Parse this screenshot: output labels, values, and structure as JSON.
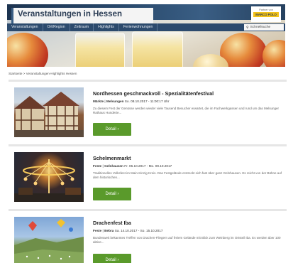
{
  "header": {
    "title": "Veranstaltungen in Hessen",
    "partner_small": "Partner von",
    "partner_brand": "MARCO POLO"
  },
  "nav": {
    "items": [
      "Veranstaltungen",
      "Ort/Region",
      "Zeitraum",
      "Highlights",
      "Ferienwohnungen"
    ],
    "search_label": "Schnellsuche",
    "search_icon": "search-icon"
  },
  "breadcrumb": "Startseite > Veranstaltungen-Highlights Hessen",
  "events": [
    {
      "title": "Nordhessen geschmackvoll - Spezialitätenfestival",
      "category": "Märkte",
      "location": "Melsungen",
      "date": "So. 08.10.2017 - 11:00:17 Uhr",
      "description": "Zu diesem Fest der Genüsse werden wieder viele Tausend Besucher erwartet, die im Fachwerkgassen und rund um das Melsunger Rathaus Hunderte...",
      "button": "Detail ›"
    },
    {
      "title": "Schelmenmarkt",
      "category": "Feste",
      "location": "Gelnhausen",
      "date": "Fr. 06.10.2017 - Mo. 09.10.2017",
      "description": "Traditionelles Volksfest im Main-Kinzig-Kreis. Das Festgelände erstreckt sich fast über ganz Gelnhausen. Es reicht von der Bühne auf dem historischen...",
      "button": "Detail ›"
    },
    {
      "title": "Drachenfest Iba",
      "category": "Feste",
      "location": "Bebra",
      "date": "Sa. 14.10.2017 - So. 15.10.2017",
      "description": "Bundesweit bekanntes Treffen von Drachen-Fliegern auf freiem Gelände mit Blick zum Weinberg im Ortsteil Iba. Es werden über 100 aktive...",
      "button": "Detail ›"
    }
  ]
}
